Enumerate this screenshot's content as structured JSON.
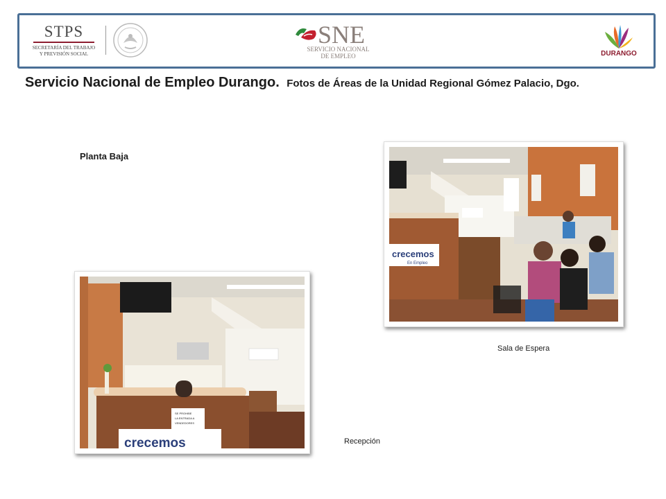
{
  "header": {
    "stps": {
      "name": "STPS",
      "line1": "SECRETARÍA DEL TRABAJO",
      "line2": "Y PREVISIÓN SOCIAL"
    },
    "seal_icon": "mexican-seal-icon",
    "sne": {
      "name": "SNE",
      "line1": "SERVICIO NACIONAL",
      "line2": "DE EMPLEO"
    },
    "durango": {
      "name": "DURANGO"
    }
  },
  "title": {
    "main": "Servicio Nacional de Empleo Durango.",
    "sub": "Fotos de Áreas de la Unidad Regional Gómez Palacio, Dgo."
  },
  "floor_label": "Planta Baja",
  "photos": {
    "waiting": {
      "caption": "Sala de Espera",
      "signs": [
        "crecemos",
        "En Empleo"
      ]
    },
    "reception": {
      "caption": "Recepción",
      "signs": [
        "crecemos",
        "SE PROHIBE",
        "LA ENTRADA A",
        "VENDEDORES"
      ]
    }
  },
  "colors": {
    "border": "#4a6f96",
    "stps_rule": "#8d1c2f",
    "sne_text": "#8a7f7a",
    "durango_text": "#8c1b2e"
  }
}
